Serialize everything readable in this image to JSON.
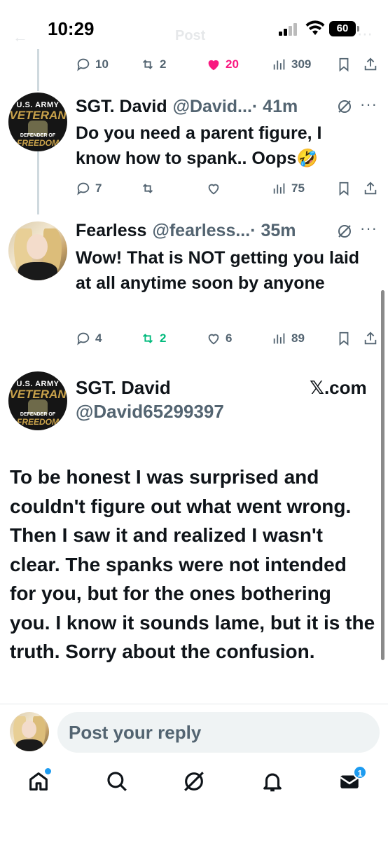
{
  "status_bar": {
    "time": "10:29",
    "battery": "60"
  },
  "header_ghost": {
    "title": "Post"
  },
  "top_actions": {
    "replies": "10",
    "reposts": "2",
    "likes": "20",
    "views": "309"
  },
  "tweets": [
    {
      "name": "SGT. David",
      "handle": "@David...",
      "time": "· 41m",
      "text": "Do you need a parent figure, I know how to spank.. Oops🤣",
      "avatar": {
        "line1": "U.S. ARMY",
        "line2": "VETERAN",
        "line3": "DEFENDER OF",
        "line4": "FREEDOM"
      },
      "actions": {
        "replies": "7",
        "reposts": "",
        "likes": "",
        "views": "75"
      }
    },
    {
      "name": "Fearless",
      "handle": "@fearless...",
      "time": "· 35m",
      "text": "Wow! That is NOT getting you laid at all anytime soon by anyone",
      "actions": {
        "replies": "4",
        "reposts": "2",
        "likes": "6",
        "views": "89"
      }
    }
  ],
  "main_tweet": {
    "name": "SGT. David",
    "handle": "@David65299397",
    "source": "𝕏.com",
    "text": "To be honest I was surprised and couldn't figure out what went wrong. Then I saw it and realized I wasn't clear. The spanks were not intended for you, but for the ones bothering you. I know it sounds lame, but it is the truth. Sorry about the confusion."
  },
  "reply": {
    "placeholder": "Post your reply"
  },
  "tabbar": {
    "messages_badge": "1"
  },
  "colors": {
    "accent": "#1d9bf0",
    "like": "#f91880",
    "repost_active": "#00ba7c",
    "muted": "#536471"
  }
}
